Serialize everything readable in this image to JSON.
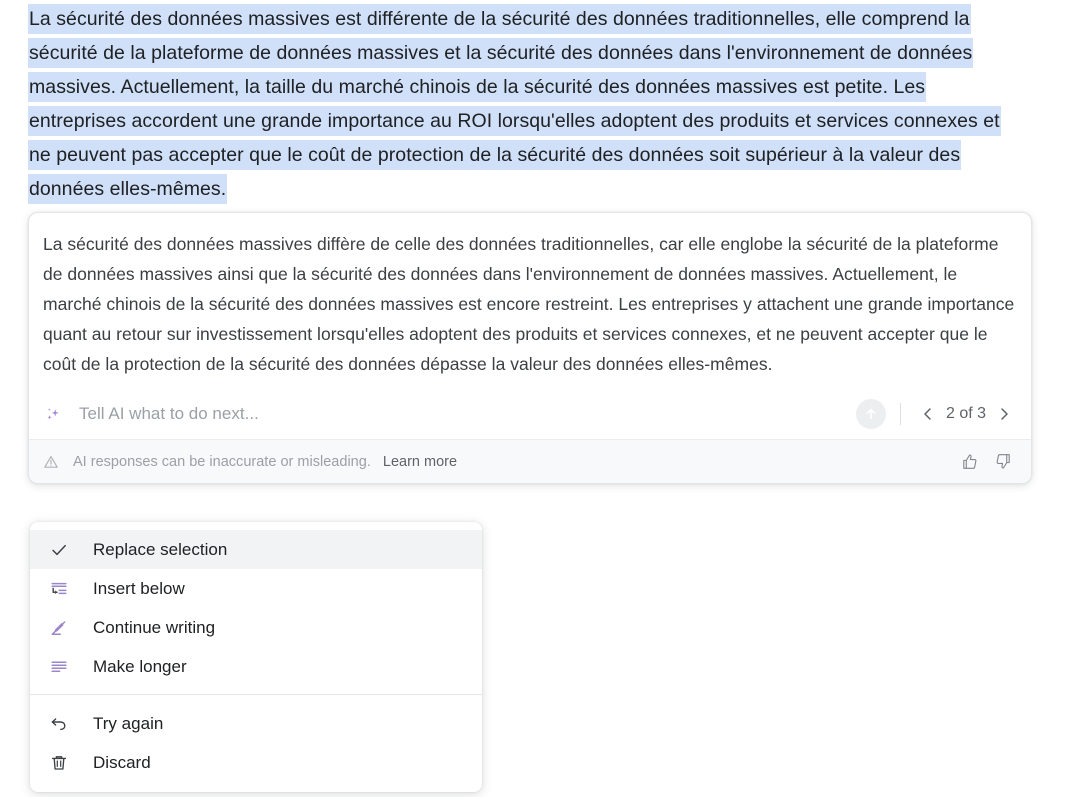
{
  "document": {
    "selected_text": "La sécurité des données massives est différente de la sécurité des données traditionnelles, elle comprend la sécurité de la plateforme de données massives et la sécurité des données dans l'environnement de données massives. Actuellement, la taille du marché chinois de la sécurité des données massives est petite. Les entreprises accordent une grande importance au ROI lorsqu'elles adoptent des produits et services connexes et ne peuvent pas accepter que le coût de protection de la sécurité des données soit supérieur à la valeur des données elles-mêmes.",
    "selection_highlight_color": "#cfe0f8"
  },
  "ai_card": {
    "response_text": "La sécurité des données massives diffère de celle des données traditionnelles, car elle englobe la sécurité de la plateforme de données massives ainsi que la sécurité des données dans l'environnement de données massives. Actuellement, le marché chinois de la sécurité des données massives est encore restreint. Les entreprises y attachent une grande importance quant au retour sur investissement lorsqu'elles adoptent des produits et services connexes, et ne peuvent accepter que le coût de la protection de la sécurité des données dépasse la valeur des données elles-mêmes.",
    "prompt": {
      "placeholder": "Tell AI what to do next...",
      "value": "",
      "icon": "sparkle-icon",
      "submit_icon": "arrow-up-circle-icon"
    },
    "pager": {
      "label": "2 of 3",
      "current": 2,
      "total": 3,
      "prev_icon": "chevron-left-icon",
      "next_icon": "chevron-right-icon"
    },
    "disclaimer": {
      "icon": "warning-triangle-icon",
      "text": "AI responses can be inaccurate or misleading.",
      "learn_more_label": "Learn more",
      "thumb_up_icon": "thumb-up-icon",
      "thumb_down_icon": "thumb-down-icon"
    }
  },
  "menu": {
    "accent_color": "#8e7cc3",
    "items": [
      {
        "label": "Replace selection",
        "icon": "check-icon",
        "selected": true
      },
      {
        "label": "Insert below",
        "icon": "insert-below-icon",
        "selected": false
      },
      {
        "label": "Continue writing",
        "icon": "pencil-icon",
        "selected": false
      },
      {
        "label": "Make longer",
        "icon": "make-longer-icon",
        "selected": false
      }
    ],
    "items_secondary": [
      {
        "label": "Try again",
        "icon": "undo-arrow-icon"
      },
      {
        "label": "Discard",
        "icon": "trash-icon"
      }
    ]
  }
}
